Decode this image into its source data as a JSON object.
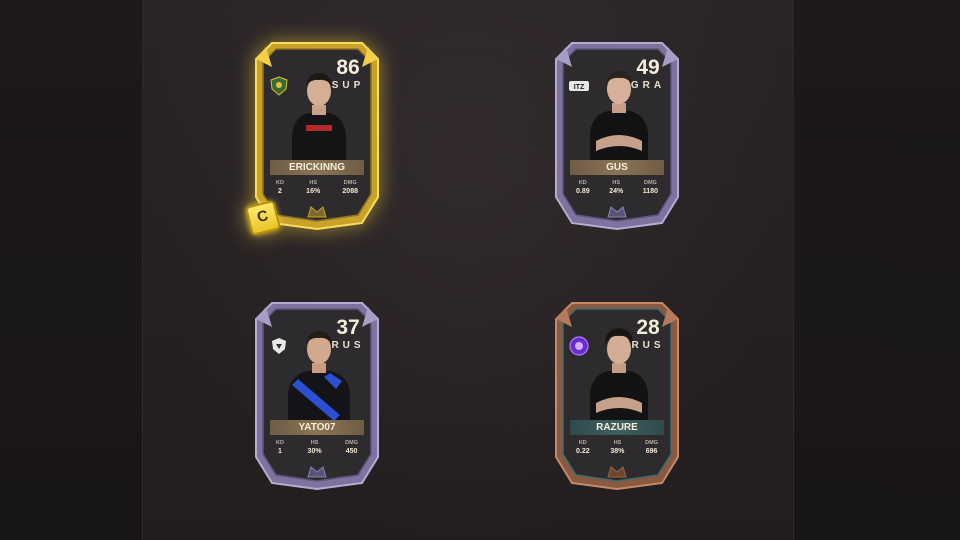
{
  "cards": [
    {
      "rating": "86",
      "position": "SUP",
      "name": "ERICKINNG",
      "tier": "gold",
      "team_logo": "shield-crest-icon",
      "captain": "C",
      "stats": [
        {
          "label": "KD",
          "value": "2"
        },
        {
          "label": "HS",
          "value": "16%"
        },
        {
          "label": "DMG",
          "value": "2088"
        }
      ]
    },
    {
      "rating": "49",
      "position": "GRA",
      "name": "GUS",
      "tier": "purple",
      "team_logo": "intz-logo-icon",
      "stats": [
        {
          "label": "KD",
          "value": "0.89"
        },
        {
          "label": "HS",
          "value": "24%"
        },
        {
          "label": "DMG",
          "value": "1180"
        }
      ]
    },
    {
      "rating": "37",
      "position": "RUS",
      "name": "YATO07",
      "tier": "purple",
      "team_logo": "white-shield-icon",
      "stats": [
        {
          "label": "KD",
          "value": "1"
        },
        {
          "label": "HS",
          "value": "30%"
        },
        {
          "label": "DMG",
          "value": "450"
        }
      ]
    },
    {
      "rating": "28",
      "position": "RUS",
      "name": "RAZURE",
      "tier": "bronze",
      "team_logo": "purple-orb-icon",
      "stats": [
        {
          "label": "KD",
          "value": "0.22"
        },
        {
          "label": "HS",
          "value": "38%"
        },
        {
          "label": "DMG",
          "value": "696"
        }
      ]
    }
  ],
  "colors": {
    "gold_frame": "#e8c431",
    "purple_frame": "#8c82b0",
    "bronze_frame": "#9a6447",
    "card_inner": "#2d2b2e",
    "background": "#231d20"
  }
}
